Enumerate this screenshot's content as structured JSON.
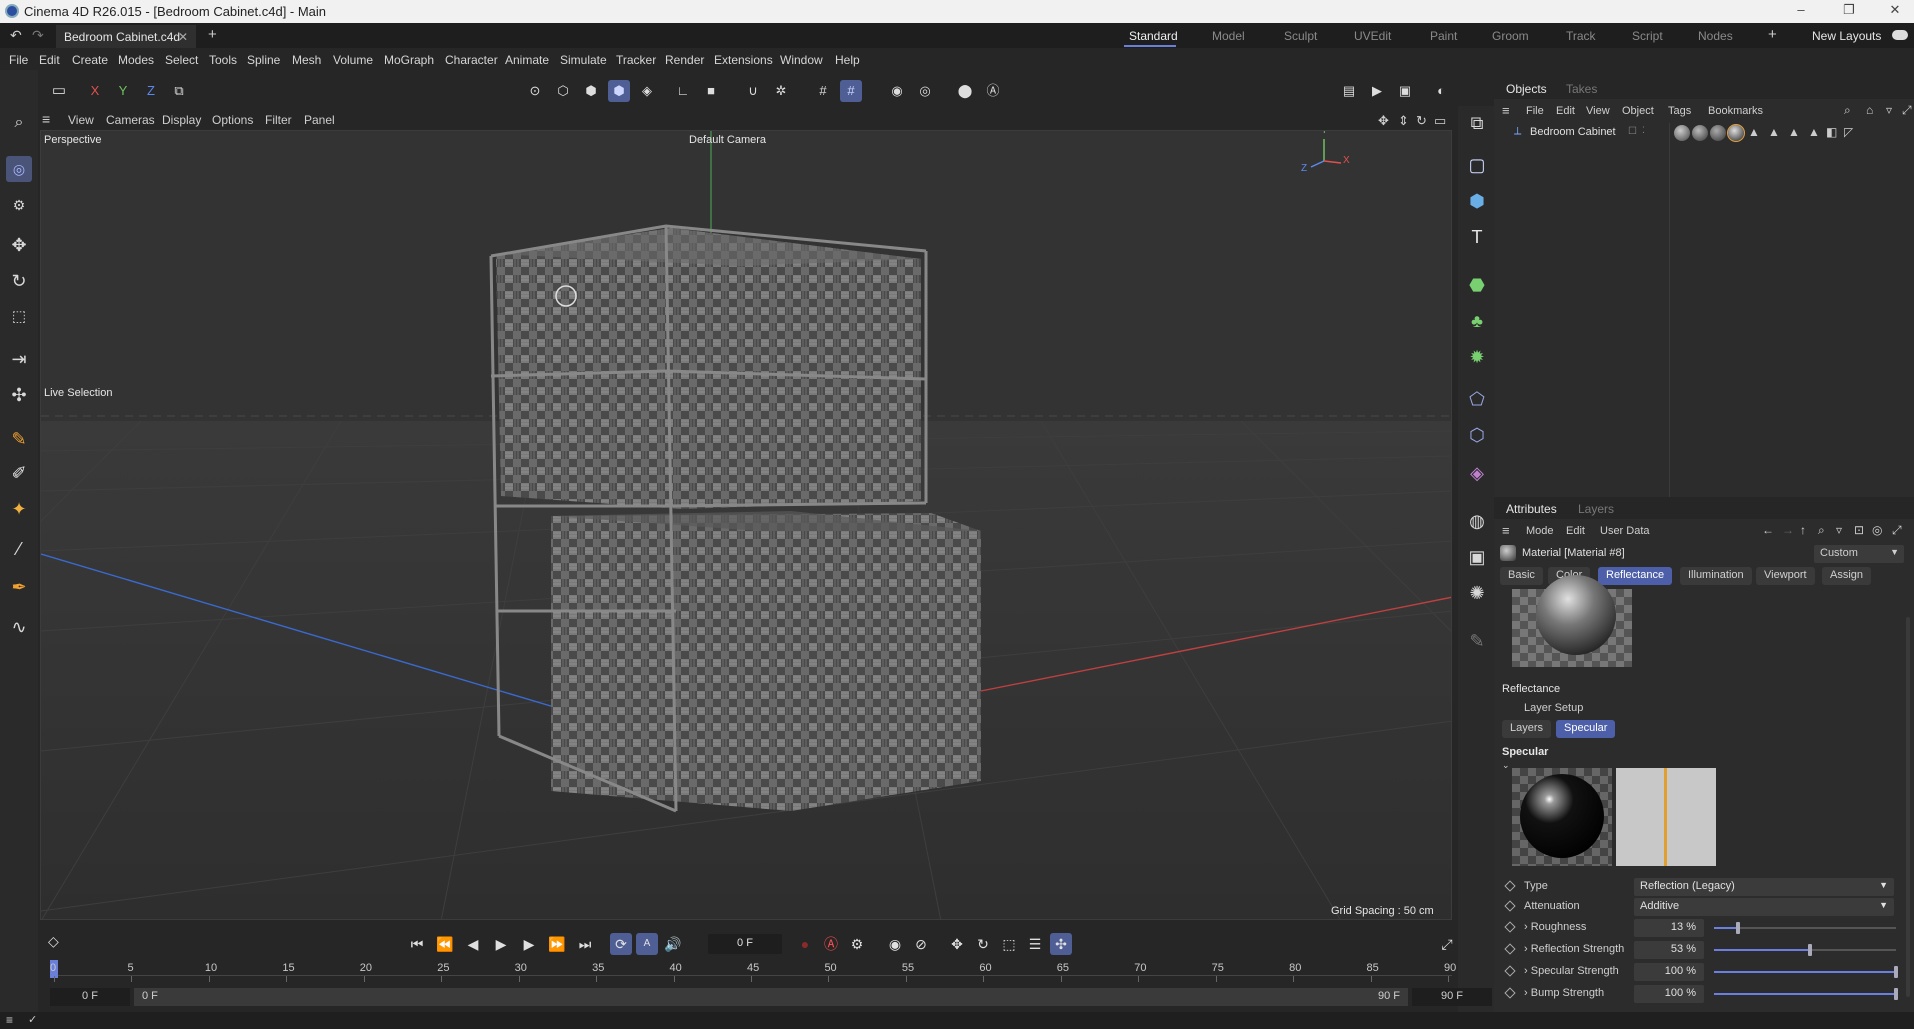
{
  "window": {
    "title": "Cinema 4D R26.015 - [Bedroom Cabinet.c4d] - Main",
    "minimize": "–",
    "maximize": "❐",
    "close": "✕"
  },
  "tabs": {
    "document": "Bedroom Cabinet.c4d",
    "close": "✕",
    "add": "+"
  },
  "layouts": {
    "items": [
      "Standard",
      "Model",
      "Sculpt",
      "UVEdit",
      "Paint",
      "Groom",
      "Track",
      "Script",
      "Nodes"
    ],
    "active": "Standard",
    "new_layouts": "New Layouts"
  },
  "menu": [
    "File",
    "Edit",
    "Create",
    "Modes",
    "Select",
    "Tools",
    "Spline",
    "Mesh",
    "Volume",
    "MoGraph",
    "Character",
    "Animate",
    "Simulate",
    "Tracker",
    "Render",
    "Extensions",
    "Window",
    "Help"
  ],
  "axis_buttons": [
    "X",
    "Y",
    "Z"
  ],
  "viewport_menu": [
    "View",
    "Cameras",
    "Display",
    "Options",
    "Filter",
    "Panel"
  ],
  "viewport": {
    "name": "Perspective",
    "camera": "Default Camera",
    "tool_label": "Live Selection",
    "grid_spacing": "Grid Spacing : 50 cm",
    "axis_labels": [
      "Y",
      "Z",
      "X"
    ]
  },
  "objects_panel": {
    "tabs": [
      "Objects",
      "Takes"
    ],
    "menu": [
      "File",
      "Edit",
      "View",
      "Object",
      "Tags",
      "Bookmarks"
    ],
    "object_name": "Bedroom Cabinet"
  },
  "attributes_panel": {
    "tabs": [
      "Attributes",
      "Layers"
    ],
    "menu": [
      "Mode",
      "Edit",
      "User Data"
    ],
    "material_name": "Material [Material #8]",
    "preset": "Custom",
    "mat_tabs": [
      "Basic",
      "Color",
      "Reflectance",
      "Illumination",
      "Viewport",
      "Assign"
    ],
    "active_mat_tab": "Reflectance",
    "section_title": "Reflectance",
    "layer_setup": "Layer Setup",
    "layer_buttons": [
      "Layers",
      "Specular"
    ],
    "specular_title": "Specular",
    "props": {
      "type": {
        "label": "Type",
        "value": "Reflection (Legacy)"
      },
      "attenuation": {
        "label": "Attenuation",
        "value": "Additive"
      },
      "roughness": {
        "label": "Roughness",
        "value": "13 %",
        "level": 0.13
      },
      "reflection_strength": {
        "label": "Reflection Strength",
        "value": "53 %",
        "level": 0.53
      },
      "specular_strength": {
        "label": "Specular Strength",
        "value": "100 %",
        "level": 1.0
      },
      "bump_strength": {
        "label": "Bump Strength",
        "value": "100 %",
        "level": 1.0
      }
    }
  },
  "timeline": {
    "current_frame": "0 F",
    "ticks": [
      "0",
      "5",
      "10",
      "15",
      "20",
      "25",
      "30",
      "35",
      "40",
      "45",
      "50",
      "55",
      "60",
      "65",
      "70",
      "75",
      "80",
      "85",
      "90"
    ],
    "start": "0 F",
    "range_start": "0 F",
    "range_end": "90 F",
    "end": "90 F"
  },
  "colors": {
    "accent": "#4d5fa8",
    "x_axis": "#c04040",
    "y_axis": "#40b060",
    "z_axis": "#3a6ad0"
  }
}
